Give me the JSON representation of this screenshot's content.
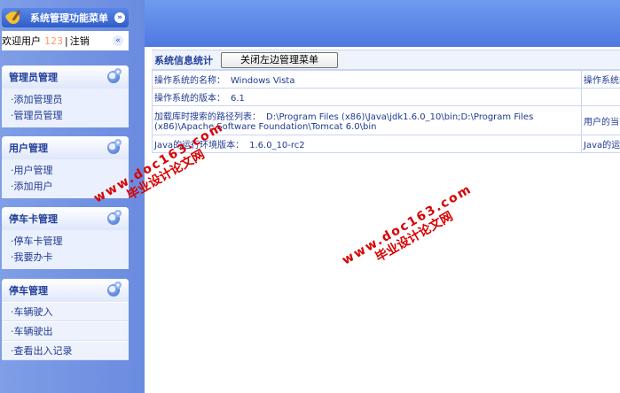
{
  "sidebar": {
    "menu_title": "系统管理功能菜单",
    "welcome": {
      "label": "欢迎用户",
      "user": "123",
      "separator": "|",
      "logout": "注销"
    },
    "groups": [
      {
        "title": "管理员管理",
        "items": [
          "·添加管理员",
          "·管理员管理"
        ]
      },
      {
        "title": "用户管理",
        "items": [
          "·用户管理",
          "·添加用户"
        ]
      },
      {
        "title": "停车卡管理",
        "items": [
          "·停车卡管理",
          "·我要办卡"
        ]
      },
      {
        "title": "停车管理",
        "items": [
          "·车辆驶入",
          "·车辆驶出",
          "·查看出入记录"
        ]
      }
    ]
  },
  "content": {
    "section_title": "系统信息统计",
    "close_button": "关闭左边管理菜单",
    "rows": [
      {
        "label": "操作系统的名称：",
        "value": "Windows Vista",
        "right": "操作系统的"
      },
      {
        "label": "操作系统的版本：",
        "value": "6.1",
        "right": ""
      },
      {
        "label": "加载库时搜索的路径列表：",
        "value": "D:\\Program Files (x86)\\Java\\jdk1.6.0_10\\bin;D:\\Program Files (x86)\\Apache Software Foundation\\Tomcat 6.0\\bin",
        "right": "用户的当前"
      },
      {
        "label": "Java的运行环境版本：",
        "value": "1.6.0_10-rc2",
        "right": "Java的运行"
      }
    ]
  },
  "watermark": {
    "name": "毕业设计论文网",
    "url": "www.doc163.com"
  },
  "colors": {
    "sidebar_bg": "#7f9ee6",
    "banner_bg": "#5a86e8",
    "text": "#1f3a93",
    "watermark": "#d80000"
  }
}
